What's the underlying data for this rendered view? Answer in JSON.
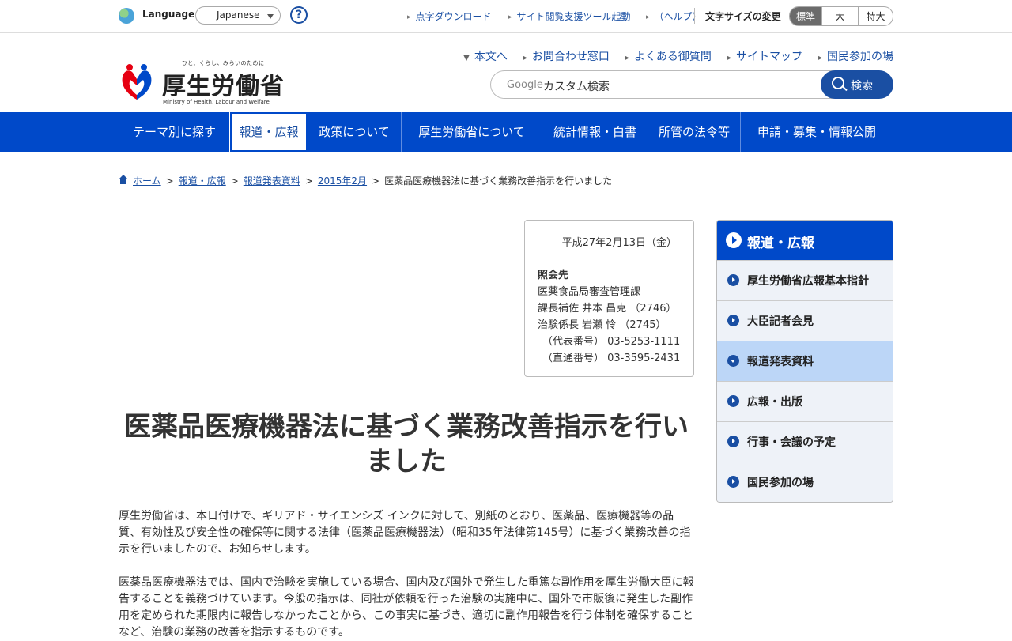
{
  "utility": {
    "language_label": "Language",
    "language_value": "Japanese",
    "help_label": "?",
    "links": [
      "点字ダウンロード",
      "サイト閲覧支援ツール起動",
      "（ヘルプ）"
    ],
    "font_size_label": "文字サイズの変更",
    "font_sizes": [
      "標準",
      "大",
      "特大"
    ],
    "font_size_active": "標準"
  },
  "header": {
    "logo_tagline": "ひと、くらし、みらいのために",
    "logo_name": "厚生労働省",
    "logo_en": "Ministry of Health, Labour and Welfare",
    "links": [
      "本文へ",
      "お問合わせ窓口",
      "よくある御質問",
      "サイトマップ",
      "国民参加の場"
    ],
    "search_brand": "Google",
    "search_placeholder": "カスタム検索",
    "search_button": "検索"
  },
  "nav": {
    "items": [
      "テーマ別に探す",
      "報道・広報",
      "政策について",
      "厚生労働省について",
      "統計情報・白書",
      "所管の法令等",
      "申請・募集・情報公開"
    ],
    "active": "報道・広報"
  },
  "breadcrumb": {
    "items": [
      "ホーム",
      "報道・広報",
      "報道発表資料",
      "2015年2月"
    ],
    "current": "医薬品医療機器法に基づく業務改善指示を行いました"
  },
  "contact": {
    "date": "平成27年2月13日（金）",
    "heading": "照会先",
    "lines": [
      "医薬食品局審査管理課",
      "課長補佐 井本 昌克 （2746）",
      "治験係長 岩瀬 怜 （2745）",
      "（代表番号） 03-5253-1111",
      "（直通番号） 03-3595-2431"
    ]
  },
  "article": {
    "title": "医薬品医療機器法に基づく業務改善指示を行いました",
    "paragraphs": [
      "厚生労働省は、本日付けで、ギリアド・サイエンシズ インクに対して、別紙のとおり、医薬品、医療機器等の品質、有効性及び安全性の確保等に関する法律（医薬品医療機器法）（昭和35年法律第145号）に基づく業務改善の指示を行いましたので、お知らせします。",
      "医薬品医療機器法では、国内で治験を実施している場合、国内及び国外で発生した重篤な副作用を厚生労働大臣に報告することを義務づけています。今般の指示は、同社が依頼を行った治験の実施中に、国外で市販後に発生した副作用を定められた期限内に報告しなかったことから、この事実に基づき、適切に副作用報告を行う体制を確保すること など、治験の業務の改善を指示するものです。"
    ]
  },
  "sidebar": {
    "heading": "報道・広報",
    "items": [
      "厚生労働省広報基本指針",
      "大臣記者会見",
      "報道発表資料",
      "広報・出版",
      "行事・会議の予定",
      "国民参加の場"
    ],
    "current": "報道発表資料"
  },
  "colors": {
    "primary": "#0049c9",
    "link": "#1a4fa3",
    "side_current": "#bcd6f7"
  }
}
